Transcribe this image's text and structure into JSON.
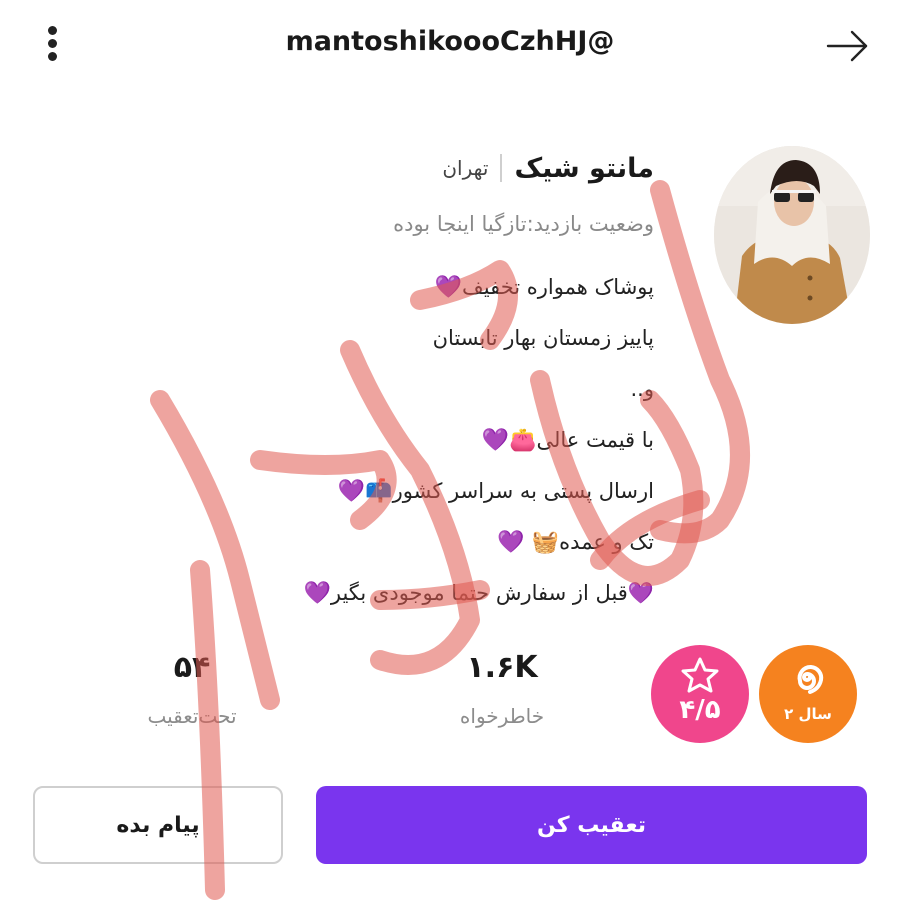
{
  "header": {
    "username": "mantoshikoooCzhHJ@",
    "menu_icon": "kebab-menu-icon",
    "back_icon": "arrow-right-icon"
  },
  "profile": {
    "name": "مانتو شیک",
    "city": "تهران",
    "visit_status": "وضعیت بازدید:تازگیا اینجا بوده",
    "bio": [
      {
        "text": "پوشاک همواره تخفیف",
        "emoji": "💜"
      },
      {
        "text": "پاییز زمستان بهار تابستان",
        "emoji": ""
      },
      {
        "text": "و..",
        "emoji": ""
      },
      {
        "text": "با قیمت عالی",
        "emoji": "👛💜"
      },
      {
        "text": "ارسال پستی به سراسر کشور",
        "emoji": "📫💜"
      },
      {
        "text": "تک و عمده",
        "emoji": "🧺 💜"
      },
      {
        "text": "💜قبل از سفارش حتما موجودی بگیر",
        "emoji": "💜"
      }
    ]
  },
  "stats": {
    "following": {
      "value": "۵۴",
      "label": "تحت‌تعقیب"
    },
    "followers": {
      "value": "۱.۶K",
      "label": "خاطرخواه"
    }
  },
  "badges": {
    "rating": {
      "value": "۴/۵",
      "icon": "star-icon",
      "color": "#f0468c"
    },
    "age": {
      "label": "۲ سال",
      "icon": "spiral-icon",
      "color": "#f5821f"
    }
  },
  "actions": {
    "message_label": "پیام بده",
    "follow_label": "تعقیب کن",
    "follow_color": "#7a35ee"
  },
  "watermark": {
    "color": "#e05a50"
  }
}
